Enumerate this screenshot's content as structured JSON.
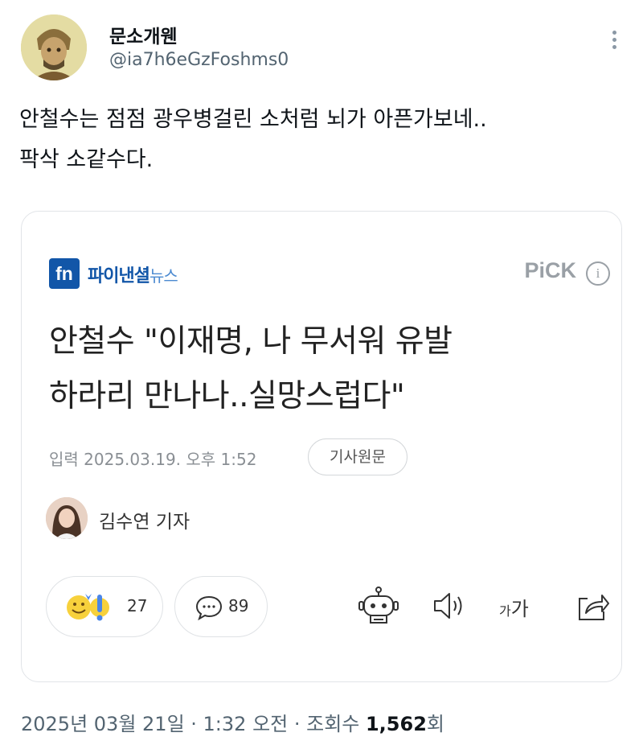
{
  "tweet": {
    "display_name": "문소개웬",
    "handle": "@ia7h6eGzFoshms0",
    "text_line1": "안철수는 점점 광우병걸린 소처럼 뇌가 아픈가보네..",
    "text_line2": "팍삭 소같수다."
  },
  "card": {
    "logo_text": "fn",
    "press_name": "파이낸셜",
    "press_sub": "뉴스",
    "pick_label": "PiCK",
    "pick_info": "i",
    "headline_line1": "안철수 \"이재명, 나 무서워 유발",
    "headline_line2": "하라리 만나나..실망스럽다\"",
    "date": "입력 2025.03.19. 오후 1:52",
    "original_button": "기사원문",
    "reporter": "김수연 기자",
    "reaction_count": "27",
    "comment_count": "89",
    "font_small": "가",
    "font_large": "가"
  },
  "footer": {
    "datetime": "2025년 03월 21일 · 1:32 오전 · 조회수 ",
    "views": "1,562",
    "views_unit": "회"
  },
  "colors": {
    "press_blue": "#1256a8",
    "secondary_text": "#536471",
    "border": "#e1e4e8"
  },
  "icons": [
    "more-icon",
    "robot-icon",
    "speaker-icon",
    "font-size-icon",
    "share-icon",
    "smile-emoji-icon",
    "exclaim-emoji-icon",
    "comment-icon"
  ]
}
